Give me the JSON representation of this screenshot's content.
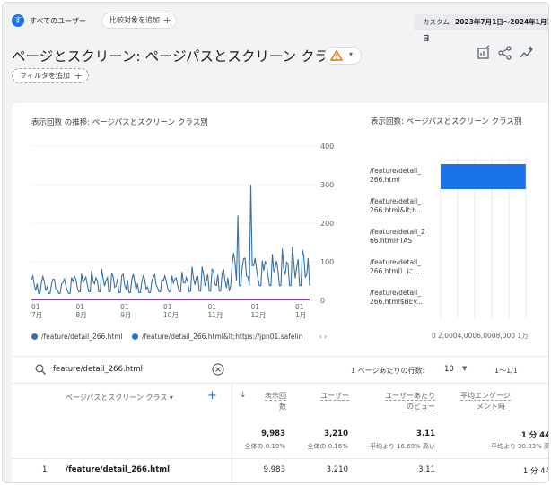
{
  "topbar": {
    "segment_initial": "す",
    "segment_label": "すべてのユーザー",
    "compare_label": "比較対象を追加",
    "plus": "+",
    "date_prefix": "カスタム",
    "date_range": "2023年7月1日〜2024年1月11日"
  },
  "header": {
    "title": "ページとスクリーン: ページパスとスクリーン クラス",
    "filter_label": "フィルタを追加",
    "colors": {
      "warning": "#e37400",
      "accent": "#1a73e8"
    }
  },
  "line_chart": {
    "title": "表示回数 の推移: ページパスとスクリーン クラス別",
    "y_ticks": [
      "400",
      "300",
      "200",
      "100",
      "0"
    ],
    "x_ticks": [
      {
        "day": "01",
        "month": "7月"
      },
      {
        "day": "01",
        "month": "8月"
      },
      {
        "day": "01",
        "month": "9月"
      },
      {
        "day": "01",
        "month": "10月"
      },
      {
        "day": "01",
        "month": "11月"
      },
      {
        "day": "01",
        "month": "12月"
      },
      {
        "day": "01",
        "month": "1月"
      }
    ],
    "legend": [
      {
        "label": "/feature/detail_266.html",
        "color": "#3a6ea5"
      },
      {
        "label": "/feature/detail_266.html&lt;https://jpn01.safelin",
        "color": "#1a73e8"
      }
    ],
    "legend_nav": "‹   ›"
  },
  "bar_chart": {
    "title": "表示回数: ページパスとスクリーン クラス別",
    "categories": [
      "/feature/detail_266.html",
      "/feature/detail_266.html&lt;h...",
      "/feature/detail_266.htmlFTAS",
      "/feature/detail_266.html）に...",
      "/feature/detail_266.html$BEy..."
    ],
    "category_lines": [
      [
        "/feature/detail_",
        "266.html"
      ],
      [
        "/feature/detail_",
        "266.html&lt;h..."
      ],
      [
        "/feature/detail_2",
        "66.htmlFTAS"
      ],
      [
        "/feature/detail_",
        "266.html）に..."
      ],
      [
        "/feature/detail_",
        "266.html$BEy..."
      ]
    ],
    "x_tick_label": "0 2,0004,0006,0008,000 1万",
    "bar_color": "#1a73e8"
  },
  "chart_data": [
    {
      "type": "line",
      "title": "表示回数 の推移: ページパスとスクリーン クラス別",
      "ylim": [
        0,
        400
      ],
      "x": [
        "2023-07-01",
        "2023-08-01",
        "2023-09-01",
        "2023-10-01",
        "2023-11-01",
        "2023-12-01",
        "2024-01-01",
        "2024-01-11"
      ],
      "series": [
        {
          "name": "/feature/detail_266.html",
          "values": [
            45,
            55,
            50,
            55,
            60,
            95,
            95,
            80
          ]
        },
        {
          "name": "/feature/detail_266.html&lt;https://jpn01.safelin",
          "values": [
            2,
            2,
            2,
            2,
            2,
            2,
            2,
            2
          ]
        }
      ],
      "peaks": [
        {
          "x": "2023-12-01",
          "y": 300
        },
        {
          "x": "2023-11-22",
          "y": 220
        }
      ]
    },
    {
      "type": "bar",
      "title": "表示回数: ページパスとスクリーン クラス別",
      "categories": [
        "/feature/detail_266.html",
        "/feature/detail_266.html&lt;h...",
        "/feature/detail_266.htmlFTAS",
        "/feature/detail_266.html）に...",
        "/feature/detail_266.html$BEy..."
      ],
      "values": [
        9983,
        0,
        0,
        0,
        0
      ],
      "xlim": [
        0,
        10000
      ]
    }
  ],
  "search": {
    "value": "feature/detail_266.html",
    "rows_label": "1 ページあたりの行数:",
    "rows_value": "10",
    "pager": "1〜1/1"
  },
  "table": {
    "dimension_header": "ページパスとスクリーン クラス",
    "dim_dropdown": "▾",
    "columns": [
      {
        "l1": "表示回",
        "l2": "数"
      },
      {
        "l1": "ユーザー",
        "l2": ""
      },
      {
        "l1": "ユーザーあたり",
        "l2": "のビュー"
      },
      {
        "l1": "平均エンゲージ",
        "l2": "メント時"
      }
    ],
    "totals": [
      {
        "value": "9,983",
        "sub": "全体の 0.19%"
      },
      {
        "value": "3,210",
        "sub": "全体の 0.16%"
      },
      {
        "value": "3.11",
        "sub": "平均より 16.69% 高い"
      },
      {
        "value": "1 分 44 ",
        "sub": "平均より 30.03% 高"
      }
    ],
    "rows": [
      {
        "index": "1",
        "page": "/feature/detail_266.html",
        "views": "9,983",
        "users": "3,210",
        "vpu": "3.11",
        "time": "1 分 44 "
      }
    ]
  }
}
